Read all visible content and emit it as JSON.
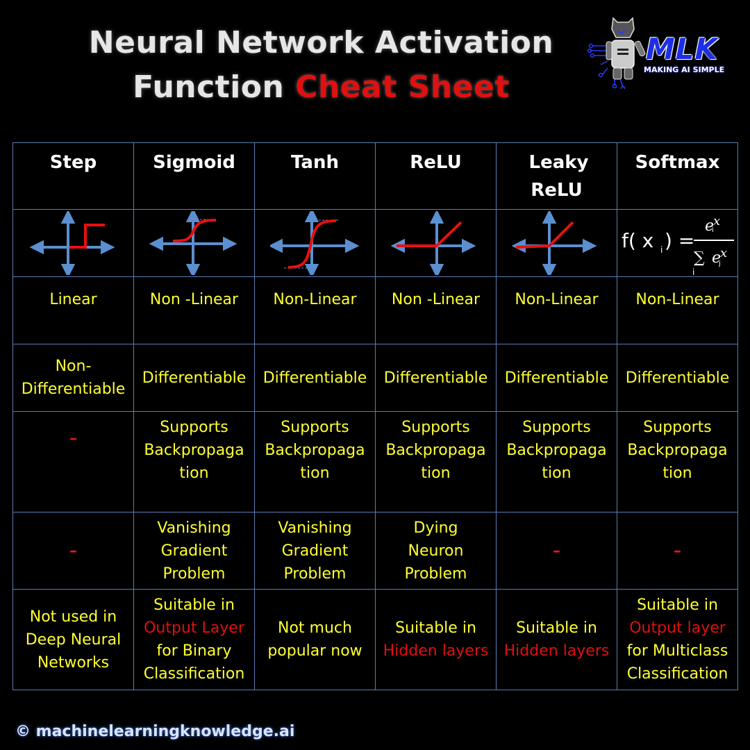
{
  "title": {
    "line1": "Neural Network Activation",
    "line2_plain": "Function",
    "line2_highlight": "Cheat Sheet"
  },
  "logo": {
    "brand": "MLK",
    "tagline": "MAKING AI SIMPLE",
    "icon": "robot-icon"
  },
  "colors": {
    "background": "#000000",
    "grid": "#5b7db4",
    "header_text": "#ffffff",
    "cell_text": "#ffff33",
    "highlight": "#e01010",
    "axis": "#5b8fd0",
    "curve": "#e81010"
  },
  "functions": [
    {
      "name": "Step",
      "graph": "step-function-graph",
      "linearity": "Linear",
      "differentiability": "Non-Differentiable",
      "backprop": "–",
      "problem": "–",
      "usage": [
        {
          "text": "Not used in Deep Neural Networks",
          "highlight": false
        }
      ]
    },
    {
      "name": "Sigmoid",
      "graph": "sigmoid-function-graph",
      "linearity": "Non -Linear",
      "differentiability": "Differentiable",
      "backprop": "Supports Backpropaga tion",
      "problem": "Vanishing Gradient Problem",
      "usage": [
        {
          "text": "Suitable in",
          "highlight": false
        },
        {
          "text": "Output Layer",
          "highlight": true
        },
        {
          "text": "for Binary Classification",
          "highlight": false
        }
      ]
    },
    {
      "name": "Tanh",
      "graph": "tanh-function-graph",
      "linearity": "Non-Linear",
      "differentiability": "Differentiable",
      "backprop": "Supports Backpropaga tion",
      "problem": "Vanishing Gradient Problem",
      "usage": [
        {
          "text": "Not much popular now",
          "highlight": false
        }
      ]
    },
    {
      "name": "ReLU",
      "graph": "relu-function-graph",
      "linearity": "Non -Linear",
      "differentiability": "Differentiable",
      "backprop": "Supports Backpropaga tion",
      "problem": "Dying Neuron Problem",
      "usage": [
        {
          "text": "Suitable in",
          "highlight": false
        },
        {
          "text": "Hidden layers",
          "highlight": true
        }
      ]
    },
    {
      "name": "Leaky ReLU",
      "graph": "leaky-relu-function-graph",
      "linearity": "Non-Linear",
      "differentiability": "Differentiable",
      "backprop": "Supports Backpropaga tion",
      "problem": "–",
      "usage": [
        {
          "text": "Suitable in",
          "highlight": false
        },
        {
          "text": "Hidden layers",
          "highlight": true
        }
      ]
    },
    {
      "name": "Softmax",
      "graph": "softmax-formula",
      "formula": {
        "lhs": "f( x i) =",
        "numerator": "e^x_i",
        "denominator": "Σ_j e^x_j"
      },
      "linearity": "Non-Linear",
      "differentiability": "Differentiable",
      "backprop": "Supports Backpropaga tion",
      "problem": "–",
      "usage": [
        {
          "text": "Suitable in",
          "highlight": false
        },
        {
          "text": "Output layer",
          "highlight": true
        },
        {
          "text": "for Multiclass Classification",
          "highlight": false
        }
      ]
    }
  ],
  "footer": "© machinelearningknowledge.ai"
}
